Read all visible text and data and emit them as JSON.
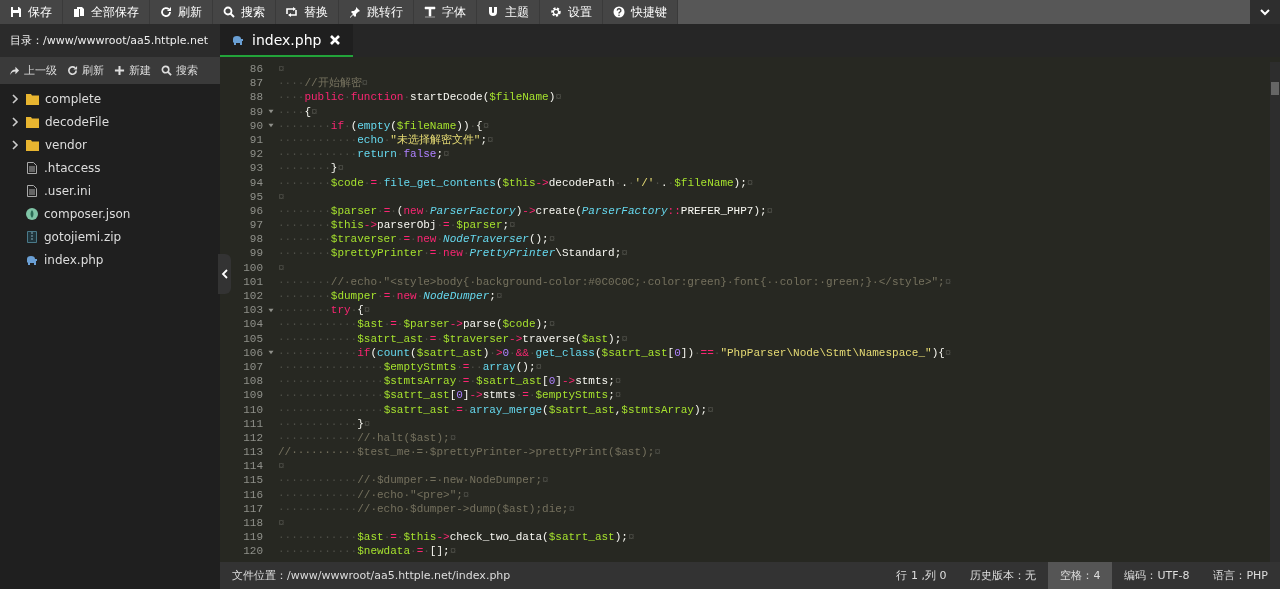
{
  "toolbar": [
    {
      "label": "保存"
    },
    {
      "label": "全部保存"
    },
    {
      "label": "刷新"
    },
    {
      "label": "搜索"
    },
    {
      "label": "替换"
    },
    {
      "label": "跳转行"
    },
    {
      "label": "字体"
    },
    {
      "label": "主题"
    },
    {
      "label": "设置"
    },
    {
      "label": "快捷键"
    }
  ],
  "sidebar": {
    "directory": "目录：/www/wwwroot/aa5.httple.net",
    "actions": [
      {
        "label": "上一级"
      },
      {
        "label": "刷新"
      },
      {
        "label": "新建"
      },
      {
        "label": "搜索"
      }
    ],
    "items": [
      {
        "name": "complete",
        "kind": "folder",
        "expanded": false
      },
      {
        "name": "decodeFile",
        "kind": "folder",
        "expanded": false
      },
      {
        "name": "vendor",
        "kind": "folder",
        "expanded": false
      },
      {
        "name": ".htaccess",
        "kind": "text"
      },
      {
        "name": ".user.ini",
        "kind": "text"
      },
      {
        "name": "composer.json",
        "kind": "json"
      },
      {
        "name": "gotojiemi.zip",
        "kind": "zip"
      },
      {
        "name": "index.php",
        "kind": "php"
      }
    ]
  },
  "tabs": [
    {
      "label": "index.php",
      "selected": true
    }
  ],
  "code": [
    {
      "n": "86",
      "fold": false,
      "t": [
        {
          "kind": "space",
          "text": "¤"
        }
      ]
    },
    {
      "n": "87",
      "fold": false,
      "t": [
        {
          "kind": "space",
          "text": "····"
        },
        {
          "kind": "comment",
          "text": "//开始解密"
        },
        {
          "kind": "space",
          "text": "¤"
        }
      ]
    },
    {
      "n": "88",
      "fold": false,
      "t": [
        {
          "kind": "space",
          "text": "····"
        },
        {
          "kind": "keyword",
          "text": "public"
        },
        {
          "kind": "space",
          "text": "·"
        },
        {
          "kind": "keyword",
          "text": "function"
        },
        {
          "kind": "space",
          "text": "·"
        },
        {
          "kind": "plain",
          "text": "startDecode("
        },
        {
          "kind": "variable",
          "text": "$fileName"
        },
        {
          "kind": "plain",
          "text": ")"
        },
        {
          "kind": "space",
          "text": "¤"
        }
      ]
    },
    {
      "n": "89",
      "fold": true,
      "t": [
        {
          "kind": "space",
          "text": "····"
        },
        {
          "kind": "plain",
          "text": "{"
        },
        {
          "kind": "space",
          "text": "¤"
        }
      ]
    },
    {
      "n": "90",
      "fold": true,
      "t": [
        {
          "kind": "space",
          "text": "········"
        },
        {
          "kind": "keyword",
          "text": "if"
        },
        {
          "kind": "space",
          "text": "·"
        },
        {
          "kind": "plain",
          "text": "("
        },
        {
          "kind": "builtin",
          "text": "empty"
        },
        {
          "kind": "plain",
          "text": "("
        },
        {
          "kind": "variable",
          "text": "$fileName"
        },
        {
          "kind": "plain",
          "text": "))"
        },
        {
          "kind": "space",
          "text": "·"
        },
        {
          "kind": "plain",
          "text": "{"
        },
        {
          "kind": "space",
          "text": "¤"
        }
      ]
    },
    {
      "n": "91",
      "fold": false,
      "t": [
        {
          "kind": "space",
          "text": "············"
        },
        {
          "kind": "builtin",
          "text": "echo"
        },
        {
          "kind": "space",
          "text": "·"
        },
        {
          "kind": "string",
          "text": "\"未选择解密文件\""
        },
        {
          "kind": "plain",
          "text": ";"
        },
        {
          "kind": "space",
          "text": "¤"
        }
      ]
    },
    {
      "n": "92",
      "fold": false,
      "t": [
        {
          "kind": "space",
          "text": "············"
        },
        {
          "kind": "builtin",
          "text": "return"
        },
        {
          "kind": "space",
          "text": "·"
        },
        {
          "kind": "number",
          "text": "false"
        },
        {
          "kind": "plain",
          "text": ";"
        },
        {
          "kind": "space",
          "text": "¤"
        }
      ]
    },
    {
      "n": "93",
      "fold": false,
      "t": [
        {
          "kind": "space",
          "text": "········"
        },
        {
          "kind": "plain",
          "text": "}"
        },
        {
          "kind": "space",
          "text": "¤"
        }
      ]
    },
    {
      "n": "94",
      "fold": false,
      "t": [
        {
          "kind": "space",
          "text": "········"
        },
        {
          "kind": "variable",
          "text": "$code"
        },
        {
          "kind": "space",
          "text": "·"
        },
        {
          "kind": "keyword",
          "text": "="
        },
        {
          "kind": "space",
          "text": "·"
        },
        {
          "kind": "builtin",
          "text": "file_get_contents"
        },
        {
          "kind": "plain",
          "text": "("
        },
        {
          "kind": "variable",
          "text": "$this"
        },
        {
          "kind": "keyword",
          "text": "->"
        },
        {
          "kind": "plain",
          "text": "decodePath"
        },
        {
          "kind": "space",
          "text": "·"
        },
        {
          "kind": "plain",
          "text": "."
        },
        {
          "kind": "space",
          "text": "·"
        },
        {
          "kind": "string",
          "text": "'/'"
        },
        {
          "kind": "space",
          "text": "·"
        },
        {
          "kind": "plain",
          "text": "."
        },
        {
          "kind": "space",
          "text": "·"
        },
        {
          "kind": "variable",
          "text": "$fileName"
        },
        {
          "kind": "plain",
          "text": ");"
        },
        {
          "kind": "space",
          "text": "¤"
        }
      ]
    },
    {
      "n": "95",
      "fold": false,
      "t": [
        {
          "kind": "space",
          "text": "¤"
        }
      ]
    },
    {
      "n": "96",
      "fold": false,
      "t": [
        {
          "kind": "space",
          "text": "········"
        },
        {
          "kind": "variable",
          "text": "$parser"
        },
        {
          "kind": "space",
          "text": "·"
        },
        {
          "kind": "keyword",
          "text": "="
        },
        {
          "kind": "space",
          "text": "·"
        },
        {
          "kind": "plain",
          "text": "("
        },
        {
          "kind": "keyword",
          "text": "new"
        },
        {
          "kind": "space",
          "text": "·"
        },
        {
          "kind": "class",
          "text": "ParserFactory"
        },
        {
          "kind": "plain",
          "text": ")"
        },
        {
          "kind": "keyword",
          "text": "->"
        },
        {
          "kind": "plain",
          "text": "create("
        },
        {
          "kind": "class",
          "text": "ParserFactory"
        },
        {
          "kind": "keyword",
          "text": "::"
        },
        {
          "kind": "plain",
          "text": "PREFER_PHP7);"
        },
        {
          "kind": "space",
          "text": "¤"
        }
      ]
    },
    {
      "n": "97",
      "fold": false,
      "t": [
        {
          "kind": "space",
          "text": "········"
        },
        {
          "kind": "variable",
          "text": "$this"
        },
        {
          "kind": "keyword",
          "text": "->"
        },
        {
          "kind": "plain",
          "text": "parserObj"
        },
        {
          "kind": "space",
          "text": "·"
        },
        {
          "kind": "keyword",
          "text": "="
        },
        {
          "kind": "space",
          "text": "·"
        },
        {
          "kind": "variable",
          "text": "$parser"
        },
        {
          "kind": "plain",
          "text": ";"
        },
        {
          "kind": "space",
          "text": "¤"
        }
      ]
    },
    {
      "n": "98",
      "fold": false,
      "t": [
        {
          "kind": "space",
          "text": "········"
        },
        {
          "kind": "variable",
          "text": "$traverser"
        },
        {
          "kind": "space",
          "text": "·"
        },
        {
          "kind": "keyword",
          "text": "="
        },
        {
          "kind": "space",
          "text": "·"
        },
        {
          "kind": "keyword",
          "text": "new"
        },
        {
          "kind": "space",
          "text": "·"
        },
        {
          "kind": "class",
          "text": "NodeTraverser"
        },
        {
          "kind": "plain",
          "text": "();"
        },
        {
          "kind": "space",
          "text": "¤"
        }
      ]
    },
    {
      "n": "99",
      "fold": false,
      "t": [
        {
          "kind": "space",
          "text": "········"
        },
        {
          "kind": "variable",
          "text": "$prettyPrinter"
        },
        {
          "kind": "space",
          "text": "·"
        },
        {
          "kind": "keyword",
          "text": "="
        },
        {
          "kind": "space",
          "text": "·"
        },
        {
          "kind": "keyword",
          "text": "new"
        },
        {
          "kind": "space",
          "text": "·"
        },
        {
          "kind": "class",
          "text": "PrettyPrinter"
        },
        {
          "kind": "plain",
          "text": "\\Standard;"
        },
        {
          "kind": "space",
          "text": "¤"
        }
      ]
    },
    {
      "n": "100",
      "fold": false,
      "t": [
        {
          "kind": "space",
          "text": "¤"
        }
      ]
    },
    {
      "n": "101",
      "fold": false,
      "t": [
        {
          "kind": "space",
          "text": "········"
        },
        {
          "kind": "comment",
          "text": "//·echo·\"<style>body{·background-color:#0C0C0C;·color:green}·font{··color:·green;}·</style>\";"
        },
        {
          "kind": "space",
          "text": "¤"
        }
      ]
    },
    {
      "n": "102",
      "fold": false,
      "t": [
        {
          "kind": "space",
          "text": "········"
        },
        {
          "kind": "variable",
          "text": "$dumper"
        },
        {
          "kind": "space",
          "text": "·"
        },
        {
          "kind": "keyword",
          "text": "="
        },
        {
          "kind": "space",
          "text": "·"
        },
        {
          "kind": "keyword",
          "text": "new"
        },
        {
          "kind": "space",
          "text": "·"
        },
        {
          "kind": "class",
          "text": "NodeDumper"
        },
        {
          "kind": "plain",
          "text": ";"
        },
        {
          "kind": "space",
          "text": "¤"
        }
      ]
    },
    {
      "n": "103",
      "fold": true,
      "t": [
        {
          "kind": "space",
          "text": "········"
        },
        {
          "kind": "keyword",
          "text": "try"
        },
        {
          "kind": "space",
          "text": "·"
        },
        {
          "kind": "plain",
          "text": "{"
        },
        {
          "kind": "space",
          "text": "¤"
        }
      ]
    },
    {
      "n": "104",
      "fold": false,
      "t": [
        {
          "kind": "space",
          "text": "············"
        },
        {
          "kind": "variable",
          "text": "$ast"
        },
        {
          "kind": "space",
          "text": "·"
        },
        {
          "kind": "keyword",
          "text": "="
        },
        {
          "kind": "space",
          "text": "·"
        },
        {
          "kind": "variable",
          "text": "$parser"
        },
        {
          "kind": "keyword",
          "text": "->"
        },
        {
          "kind": "plain",
          "text": "parse("
        },
        {
          "kind": "variable",
          "text": "$code"
        },
        {
          "kind": "plain",
          "text": ");"
        },
        {
          "kind": "space",
          "text": "¤"
        }
      ]
    },
    {
      "n": "105",
      "fold": false,
      "t": [
        {
          "kind": "space",
          "text": "············"
        },
        {
          "kind": "variable",
          "text": "$satrt_ast"
        },
        {
          "kind": "space",
          "text": "·"
        },
        {
          "kind": "keyword",
          "text": "="
        },
        {
          "kind": "space",
          "text": "·"
        },
        {
          "kind": "variable",
          "text": "$traverser"
        },
        {
          "kind": "keyword",
          "text": "->"
        },
        {
          "kind": "plain",
          "text": "traverse("
        },
        {
          "kind": "variable",
          "text": "$ast"
        },
        {
          "kind": "plain",
          "text": ");"
        },
        {
          "kind": "space",
          "text": "¤"
        }
      ]
    },
    {
      "n": "106",
      "fold": true,
      "t": [
        {
          "kind": "space",
          "text": "············"
        },
        {
          "kind": "keyword",
          "text": "if"
        },
        {
          "kind": "plain",
          "text": "("
        },
        {
          "kind": "builtin",
          "text": "count"
        },
        {
          "kind": "plain",
          "text": "("
        },
        {
          "kind": "variable",
          "text": "$satrt_ast"
        },
        {
          "kind": "plain",
          "text": ")"
        },
        {
          "kind": "space",
          "text": "·"
        },
        {
          "kind": "keyword",
          "text": ">"
        },
        {
          "kind": "number",
          "text": "0"
        },
        {
          "kind": "space",
          "text": "·"
        },
        {
          "kind": "keyword",
          "text": "&&"
        },
        {
          "kind": "space",
          "text": "·"
        },
        {
          "kind": "builtin",
          "text": "get_class"
        },
        {
          "kind": "plain",
          "text": "("
        },
        {
          "kind": "variable",
          "text": "$satrt_ast"
        },
        {
          "kind": "plain",
          "text": "["
        },
        {
          "kind": "number",
          "text": "0"
        },
        {
          "kind": "plain",
          "text": "])"
        },
        {
          "kind": "space",
          "text": "·"
        },
        {
          "kind": "keyword",
          "text": "=="
        },
        {
          "kind": "space",
          "text": "·"
        },
        {
          "kind": "string",
          "text": "\"PhpParser\\Node\\Stmt\\Namespace_\""
        },
        {
          "kind": "plain",
          "text": "){"
        },
        {
          "kind": "space",
          "text": "¤"
        }
      ]
    },
    {
      "n": "107",
      "fold": false,
      "t": [
        {
          "kind": "space",
          "text": "················"
        },
        {
          "kind": "variable",
          "text": "$emptyStmts"
        },
        {
          "kind": "space",
          "text": "·"
        },
        {
          "kind": "keyword",
          "text": "="
        },
        {
          "kind": "space",
          "text": "··"
        },
        {
          "kind": "builtin",
          "text": "array"
        },
        {
          "kind": "plain",
          "text": "();"
        },
        {
          "kind": "space",
          "text": "¤"
        }
      ]
    },
    {
      "n": "108",
      "fold": false,
      "t": [
        {
          "kind": "space",
          "text": "················"
        },
        {
          "kind": "variable",
          "text": "$stmtsArray"
        },
        {
          "kind": "space",
          "text": "·"
        },
        {
          "kind": "keyword",
          "text": "="
        },
        {
          "kind": "space",
          "text": "·"
        },
        {
          "kind": "variable",
          "text": "$satrt_ast"
        },
        {
          "kind": "plain",
          "text": "["
        },
        {
          "kind": "number",
          "text": "0"
        },
        {
          "kind": "plain",
          "text": "]"
        },
        {
          "kind": "keyword",
          "text": "->"
        },
        {
          "kind": "plain",
          "text": "stmts;"
        },
        {
          "kind": "space",
          "text": "¤"
        }
      ]
    },
    {
      "n": "109",
      "fold": false,
      "t": [
        {
          "kind": "space",
          "text": "················"
        },
        {
          "kind": "variable",
          "text": "$satrt_ast"
        },
        {
          "kind": "plain",
          "text": "["
        },
        {
          "kind": "number",
          "text": "0"
        },
        {
          "kind": "plain",
          "text": "]"
        },
        {
          "kind": "keyword",
          "text": "->"
        },
        {
          "kind": "plain",
          "text": "stmts"
        },
        {
          "kind": "space",
          "text": "·"
        },
        {
          "kind": "keyword",
          "text": "="
        },
        {
          "kind": "space",
          "text": "·"
        },
        {
          "kind": "variable",
          "text": "$emptyStmts"
        },
        {
          "kind": "plain",
          "text": ";"
        },
        {
          "kind": "space",
          "text": "¤"
        }
      ]
    },
    {
      "n": "110",
      "fold": false,
      "t": [
        {
          "kind": "space",
          "text": "················"
        },
        {
          "kind": "variable",
          "text": "$satrt_ast"
        },
        {
          "kind": "space",
          "text": "·"
        },
        {
          "kind": "keyword",
          "text": "="
        },
        {
          "kind": "space",
          "text": "·"
        },
        {
          "kind": "builtin",
          "text": "array_merge"
        },
        {
          "kind": "plain",
          "text": "("
        },
        {
          "kind": "variable",
          "text": "$satrt_ast"
        },
        {
          "kind": "plain",
          "text": ","
        },
        {
          "kind": "variable",
          "text": "$stmtsArray"
        },
        {
          "kind": "plain",
          "text": ");"
        },
        {
          "kind": "space",
          "text": "¤"
        }
      ]
    },
    {
      "n": "111",
      "fold": false,
      "t": [
        {
          "kind": "space",
          "text": "············"
        },
        {
          "kind": "plain",
          "text": "}"
        },
        {
          "kind": "space",
          "text": "¤"
        }
      ]
    },
    {
      "n": "112",
      "fold": false,
      "t": [
        {
          "kind": "space",
          "text": "············"
        },
        {
          "kind": "comment",
          "text": "//·halt($ast);"
        },
        {
          "kind": "space",
          "text": "¤"
        }
      ]
    },
    {
      "n": "113",
      "fold": false,
      "t": [
        {
          "kind": "comment",
          "text": "//··········$test_me·=·$prettyPrinter->prettyPrint($ast);"
        },
        {
          "kind": "space",
          "text": "¤"
        }
      ]
    },
    {
      "n": "114",
      "fold": false,
      "t": [
        {
          "kind": "space",
          "text": "¤"
        }
      ]
    },
    {
      "n": "115",
      "fold": false,
      "t": [
        {
          "kind": "space",
          "text": "············"
        },
        {
          "kind": "comment",
          "text": "//·$dumper·=·new·NodeDumper;"
        },
        {
          "kind": "space",
          "text": "¤"
        }
      ]
    },
    {
      "n": "116",
      "fold": false,
      "t": [
        {
          "kind": "space",
          "text": "············"
        },
        {
          "kind": "comment",
          "text": "//·echo·\"<pre>\";"
        },
        {
          "kind": "space",
          "text": "¤"
        }
      ]
    },
    {
      "n": "117",
      "fold": false,
      "t": [
        {
          "kind": "space",
          "text": "············"
        },
        {
          "kind": "comment",
          "text": "//·echo·$dumper->dump($ast);die;"
        },
        {
          "kind": "space",
          "text": "¤"
        }
      ]
    },
    {
      "n": "118",
      "fold": false,
      "t": [
        {
          "kind": "space",
          "text": "¤"
        }
      ]
    },
    {
      "n": "119",
      "fold": false,
      "t": [
        {
          "kind": "space",
          "text": "············"
        },
        {
          "kind": "variable",
          "text": "$ast"
        },
        {
          "kind": "space",
          "text": "·"
        },
        {
          "kind": "keyword",
          "text": "="
        },
        {
          "kind": "space",
          "text": "·"
        },
        {
          "kind": "variable",
          "text": "$this"
        },
        {
          "kind": "keyword",
          "text": "->"
        },
        {
          "kind": "plain",
          "text": "check_two_data("
        },
        {
          "kind": "variable",
          "text": "$satrt_ast"
        },
        {
          "kind": "plain",
          "text": ");"
        },
        {
          "kind": "space",
          "text": "¤"
        }
      ]
    },
    {
      "n": "120",
      "fold": false,
      "t": [
        {
          "kind": "space",
          "text": "············"
        },
        {
          "kind": "variable",
          "text": "$newdata"
        },
        {
          "kind": "space",
          "text": "·"
        },
        {
          "kind": "keyword",
          "text": "="
        },
        {
          "kind": "space",
          "text": "·"
        },
        {
          "kind": "plain",
          "text": "[];"
        },
        {
          "kind": "space",
          "text": "¤"
        }
      ]
    }
  ],
  "status_bar": {
    "file_location": "文件位置：/www/wwwroot/aa5.httple.net/index.php",
    "items": [
      {
        "text": "行 1 ,列 0",
        "selected": false
      },
      {
        "text": "历史版本：无",
        "selected": false
      },
      {
        "text": "空格：4",
        "selected": true
      },
      {
        "text": "编码：UTF-8",
        "selected": false
      },
      {
        "text": "语言：PHP",
        "selected": false
      }
    ]
  }
}
